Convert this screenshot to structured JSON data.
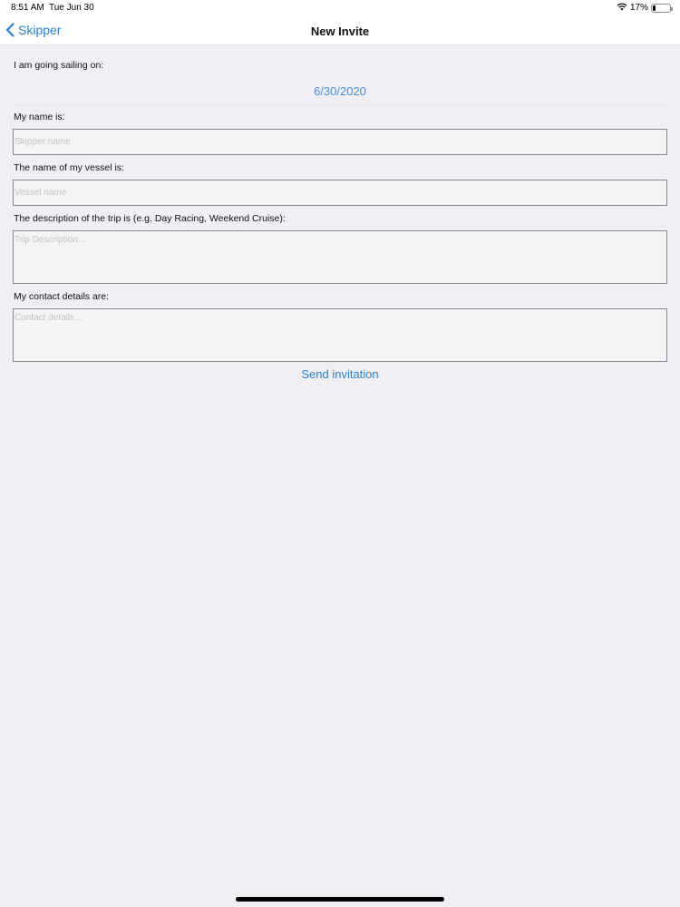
{
  "status_bar": {
    "time": "8:51 AM",
    "date": "Tue Jun 30",
    "battery": "17%",
    "battery_level": 0.17,
    "wifi_icon": "wifi-icon"
  },
  "nav": {
    "back_label": "Skipper",
    "title": "New Invite"
  },
  "form": {
    "sailing_label": "I am going sailing on:",
    "date": "6/30/2020",
    "name_label": "My name is:",
    "name_placeholder": "Skipper name",
    "vessel_label": "The name of my vessel is:",
    "vessel_placeholder": "Vessel name",
    "description_label": "The description of the trip is (e.g. Day Racing, Weekend Cruise):",
    "description_placeholder": "Trip Description...",
    "contact_label": "My contact details are:",
    "contact_placeholder": "Contact details...",
    "send_label": "Send invitation"
  },
  "colors": {
    "accent": "#2c7fc9",
    "background": "#efeff4"
  }
}
